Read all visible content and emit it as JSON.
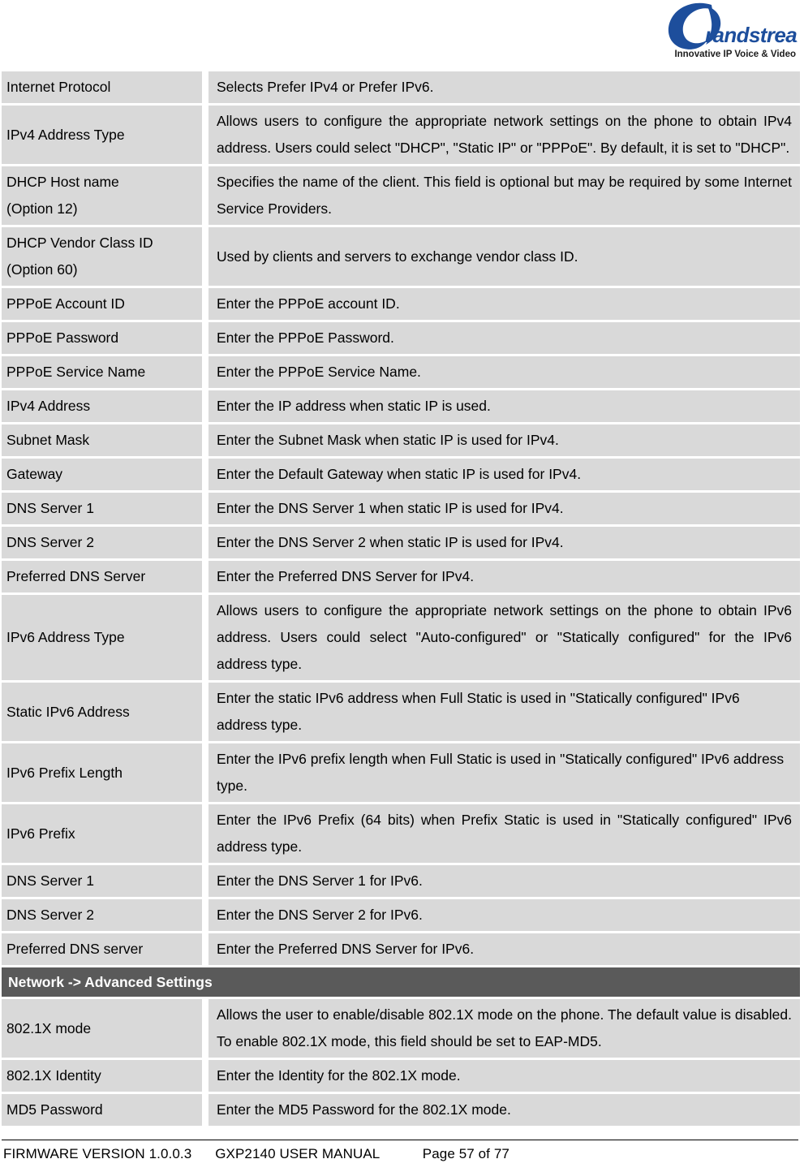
{
  "document": {
    "logo": {
      "icon": "grandstream-logo",
      "wordmark": "randstream",
      "tagline": "Innovative IP Voice & Video",
      "brand_color": "#1d4e9c"
    },
    "colors": {
      "cell_background": "#d9d9d9",
      "section_band": "#5a5a5a",
      "page_background": "#ffffff",
      "text": "#000000"
    }
  },
  "table": {
    "rows": [
      {
        "term": "Internet Protocol",
        "description": "Selects Prefer IPv4 or Prefer IPv6.",
        "justify": false
      },
      {
        "term": "IPv4 Address Type",
        "description": "Allows users to configure the appropriate network settings on the phone to obtain IPv4 address. Users could select \"DHCP\", \"Static IP\" or \"PPPoE\". By default, it is set to \"DHCP\".",
        "justify": true
      },
      {
        "term": "DHCP Host name (Option 12)",
        "term_line1": "DHCP Host name",
        "term_line2": "(Option 12)",
        "description": "Specifies the name of the client. This field is optional but may be required by some Internet Service Providers.",
        "justify": true
      },
      {
        "term": "DHCP Vendor Class ID (Option 60)",
        "term_line1": "DHCP Vendor Class ID",
        "term_line2": "(Option 60)",
        "description": "Used by clients and servers to exchange vendor class ID.",
        "justify": false
      },
      {
        "term": "PPPoE Account ID",
        "description": "Enter the PPPoE account ID.",
        "justify": false
      },
      {
        "term": "PPPoE Password",
        "description": "Enter the PPPoE Password.",
        "justify": false
      },
      {
        "term": "PPPoE Service Name",
        "description": "Enter the PPPoE Service Name.",
        "justify": false
      },
      {
        "term": "IPv4 Address",
        "description": "Enter the IP address when static IP is used.",
        "justify": false
      },
      {
        "term": "Subnet Mask",
        "description": "Enter the Subnet Mask when static IP is used for IPv4.",
        "justify": false
      },
      {
        "term": "Gateway",
        "description": "Enter the Default Gateway when static IP is used for IPv4.",
        "justify": false
      },
      {
        "term": "DNS Server 1",
        "description": "Enter the DNS Server 1 when static IP is used for IPv4.",
        "justify": false
      },
      {
        "term": "DNS Server 2",
        "description": "Enter the DNS Server 2 when static IP is used for IPv4.",
        "justify": false
      },
      {
        "term": "Preferred DNS Server",
        "description": "Enter the Preferred DNS Server for IPv4.",
        "justify": false
      },
      {
        "term": "IPv6 Address Type",
        "description": "Allows users to configure the appropriate network settings on the phone to obtain IPv6 address. Users could select \"Auto-configured\" or \"Statically configured\" for the IPv6 address type.",
        "justify": true
      },
      {
        "term": "Static IPv6 Address",
        "description": "Enter the static IPv6 address when Full Static is used in \"Statically configured\" IPv6 address type.",
        "justify": false
      },
      {
        "term": "IPv6 Prefix Length",
        "description": "Enter the IPv6 prefix length when Full Static is used in \"Statically configured\" IPv6 address type.",
        "justify": false
      },
      {
        "term": "IPv6 Prefix",
        "description": "Enter the IPv6 Prefix (64 bits) when Prefix Static is used in \"Statically configured\" IPv6 address type.",
        "justify": true
      },
      {
        "term": "DNS Server 1",
        "description": "Enter the DNS Server 1 for IPv6.",
        "justify": false
      },
      {
        "term": "DNS Server 2",
        "description": "Enter the DNS Server 2 for IPv6.",
        "justify": false
      },
      {
        "term": "Preferred DNS server",
        "description": "Enter the Preferred DNS Server for IPv6.",
        "justify": false
      }
    ],
    "section_header": "Network -> Advanced Settings",
    "rows_after_section": [
      {
        "term": "802.1X mode",
        "description": "Allows the user to enable/disable 802.1X mode on the phone. The default value is disabled. To enable 802.1X mode, this field should be set to EAP-MD5.",
        "justify": true
      },
      {
        "term": "802.1X Identity",
        "description": "Enter the Identity for the 802.1X mode.",
        "justify": false
      },
      {
        "term": "MD5 Password",
        "description": "Enter the MD5 Password for the 802.1X mode.",
        "justify": false
      }
    ]
  },
  "footer": {
    "firmware": "FIRMWARE VERSION 1.0.0.3",
    "manual": "GXP2140 USER MANUAL",
    "page": "Page 57 of 77",
    "full_text": "FIRMWARE VERSION 1.0.0.3      GXP2140 USER MANUAL           Page 57 of 77"
  }
}
